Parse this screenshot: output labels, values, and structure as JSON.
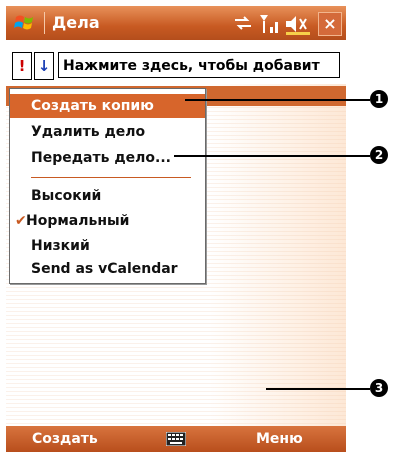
{
  "title_bar": {
    "title": "Дела",
    "close_label": "×"
  },
  "entry_bar": {
    "priority_high": "!",
    "priority_low": "↓",
    "entry_placeholder": "Нажмите здесь, чтобы добавит"
  },
  "context_menu": {
    "items": [
      {
        "label": "Создать копию",
        "selected": true
      },
      {
        "label": "Удалить дело"
      },
      {
        "label": "Передать дело..."
      },
      {
        "label": "Высокий"
      },
      {
        "label": "Нормальный",
        "checked": true
      },
      {
        "label": "Низкий"
      },
      {
        "label": "Send as vCalendar"
      }
    ],
    "check_glyph": "✔"
  },
  "bottom_bar": {
    "left_softkey": "Создать",
    "right_softkey": "Меню"
  },
  "callouts": [
    "1",
    "2",
    "3"
  ],
  "colors": {
    "accent": "#c85a22",
    "selection": "#d7652b"
  }
}
